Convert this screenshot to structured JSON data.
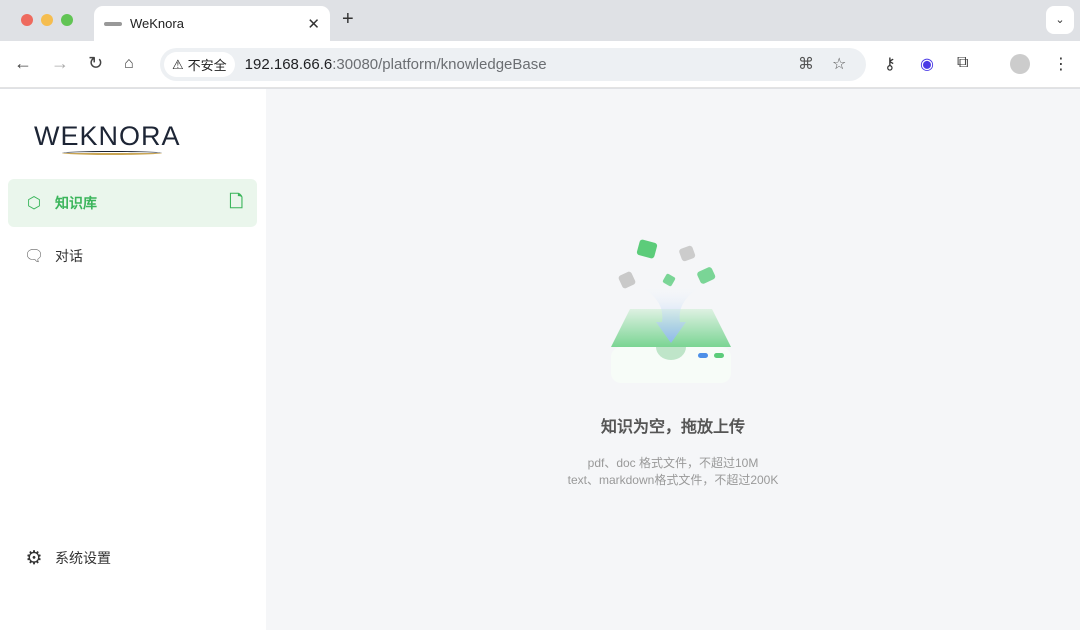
{
  "browser": {
    "tab_title": "WeKnora",
    "insecure_label": "不安全",
    "url_host": "192.168.66.6",
    "url_rest": ":30080/platform/knowledgeBase"
  },
  "sidebar": {
    "logo": "WEKNORA",
    "items": [
      {
        "label": "知识库"
      },
      {
        "label": "对话"
      }
    ],
    "settings": "系统设置"
  },
  "main": {
    "empty_title": "知识为空，拖放上传",
    "hint1": "pdf、doc 格式文件，不超过10M",
    "hint2": "text、markdown格式文件，不超过200K"
  },
  "colors": {
    "accent": "#3bb55b"
  }
}
